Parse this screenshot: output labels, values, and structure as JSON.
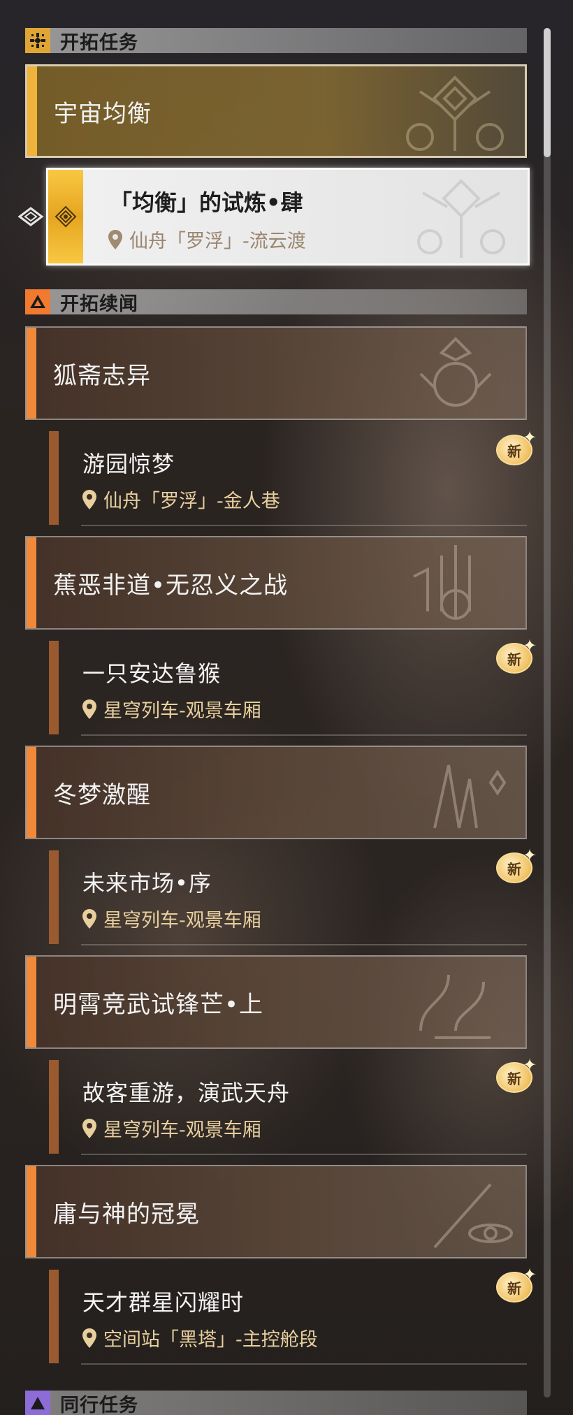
{
  "sections": {
    "trailblaze": {
      "title": "开拓任务",
      "icon": "trailblaze-mission-icon"
    },
    "continuance": {
      "title": "开拓续闻",
      "icon": "trailblaze-continuance-icon"
    },
    "companion": {
      "title": "同行任务",
      "icon": "companion-mission-icon"
    }
  },
  "trailblaze_chapter": {
    "title": "宇宙均衡"
  },
  "active_quest": {
    "title": "「均衡」的试炼•肆",
    "location": "仙舟「罗浮」-流云渡"
  },
  "chapters": [
    {
      "title": "狐斋志异",
      "quest": {
        "title": "游园惊梦",
        "location": "仙舟「罗浮」-金人巷",
        "badge": "新"
      }
    },
    {
      "title": "蕉恶非道•无忍义之战",
      "quest": {
        "title": "一只安达鲁猴",
        "location": "星穹列车-观景车厢",
        "badge": "新"
      }
    },
    {
      "title": "冬梦激醒",
      "quest": {
        "title": "未来市场•序",
        "location": "星穹列车-观景车厢",
        "badge": "新"
      }
    },
    {
      "title": "明霄竞武试锋芒•上",
      "quest": {
        "title": "故客重游，演武天舟",
        "location": "星穹列车-观景车厢",
        "badge": "新"
      }
    },
    {
      "title": "庸与神的冠冕",
      "quest": {
        "title": "天才群星闪耀时",
        "location": "空间站「黑塔」-主控舱段",
        "badge": "新"
      }
    }
  ],
  "colors": {
    "gold_accent": "#efb23a",
    "orange_accent": "#f08a3a",
    "quest_bar": "#9a5a30",
    "location_text": "#e8cf9e"
  }
}
